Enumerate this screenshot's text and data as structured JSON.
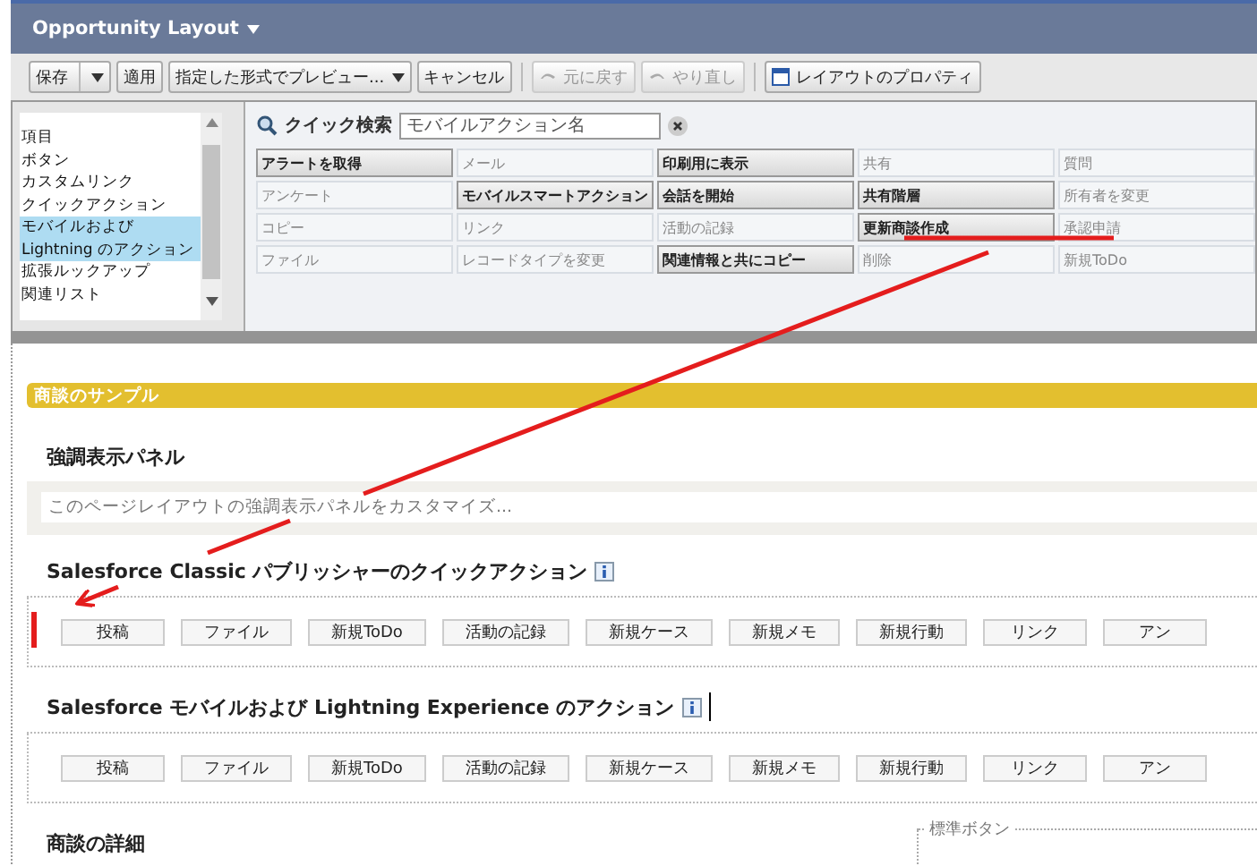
{
  "window": {
    "title": "Opportunity Layout"
  },
  "toolbar": [
    {
      "label": "保存",
      "kind": "split",
      "disabled": false
    },
    {
      "label": "適用",
      "kind": "plain",
      "disabled": false
    },
    {
      "label": "指定した形式でプレビュー...",
      "kind": "dropdown",
      "disabled": false
    },
    {
      "label": "キャンセル",
      "kind": "plain",
      "disabled": false
    },
    {
      "label": "元に戻す",
      "kind": "undo",
      "disabled": true
    },
    {
      "label": "やり直し",
      "kind": "redo",
      "disabled": true
    },
    {
      "label": "レイアウトのプロパティ",
      "kind": "properties",
      "disabled": false
    }
  ],
  "palette": {
    "categories": [
      {
        "label": "項目",
        "selected": false
      },
      {
        "label": "ボタン",
        "selected": false
      },
      {
        "label": "カスタムリンク",
        "selected": false
      },
      {
        "label": "クイックアクション",
        "selected": false
      },
      {
        "label": "モバイルおよび Lightning のアクション",
        "selected": true
      },
      {
        "label": "拡張ルックアップ",
        "selected": false
      },
      {
        "label": "関連リスト",
        "selected": false
      }
    ],
    "quick_find": {
      "label": "クイック検索",
      "placeholder": "モバイルアクション名"
    },
    "items": [
      {
        "label": "アラートを取得",
        "used": false
      },
      {
        "label": "メール",
        "used": true
      },
      {
        "label": "印刷用に表示",
        "used": false
      },
      {
        "label": "共有",
        "used": true
      },
      {
        "label": "質問",
        "used": true
      },
      {
        "label": "アンケート",
        "used": true
      },
      {
        "label": "モバイルスマートアクション",
        "used": false
      },
      {
        "label": "会話を開始",
        "used": false
      },
      {
        "label": "共有階層",
        "used": false
      },
      {
        "label": "所有者を変更",
        "used": true
      },
      {
        "label": "コピー",
        "used": true
      },
      {
        "label": "リンク",
        "used": true
      },
      {
        "label": "活動の記録",
        "used": true
      },
      {
        "label": "更新商談作成",
        "used": false
      },
      {
        "label": "承認申請",
        "used": true
      },
      {
        "label": "ファイル",
        "used": true
      },
      {
        "label": "レコードタイプを変更",
        "used": true
      },
      {
        "label": "関連情報と共にコピー",
        "used": false
      },
      {
        "label": "削除",
        "used": true
      },
      {
        "label": "新規ToDo",
        "used": true
      }
    ]
  },
  "layout": {
    "section_title": "商談のサンプル",
    "highlights_panel": {
      "heading": "強調表示パネル",
      "placeholder": "このページレイアウトの強調表示パネルをカスタマイズ..."
    },
    "classic_actions": {
      "heading": "Salesforce Classic パブリッシャーのクイックアクション",
      "actions": [
        "投稿",
        "ファイル",
        "新規ToDo",
        "活動の記録",
        "新規ケース",
        "新規メモ",
        "新規行動",
        "リンク",
        "アン"
      ]
    },
    "lightning_actions": {
      "heading": "Salesforce モバイルおよび Lightning Experience のアクション",
      "actions": [
        "投稿",
        "ファイル",
        "新規ToDo",
        "活動の記録",
        "新規ケース",
        "新規メモ",
        "新規行動",
        "リンク",
        "アン"
      ]
    },
    "details": {
      "heading": "商談の詳細",
      "standard_buttons": {
        "legend": "標準ボタン"
      }
    }
  }
}
